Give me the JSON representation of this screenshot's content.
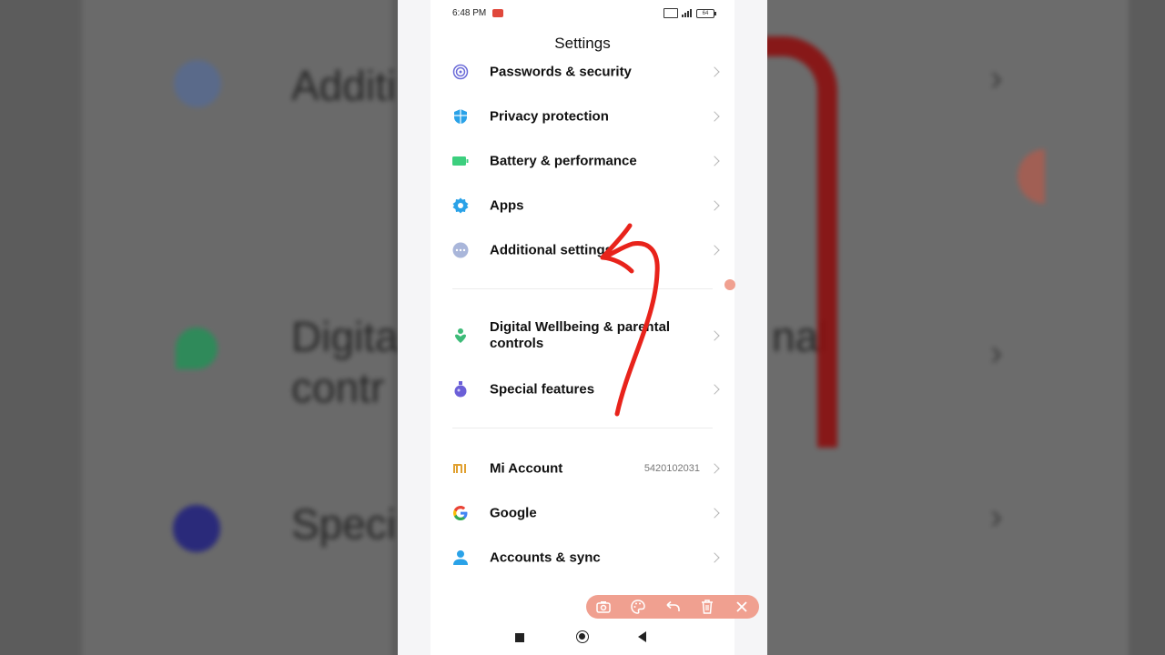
{
  "background": {
    "texts": [
      "Additi",
      "Digita",
      "contr",
      "nal",
      "Speci"
    ]
  },
  "status_bar": {
    "time": "6:48 PM",
    "battery": "64"
  },
  "header": {
    "title": "Settings"
  },
  "settings_items": [
    {
      "label": "Passwords & security",
      "icon": "fingerprint-icon"
    },
    {
      "label": "Privacy protection",
      "icon": "shield-icon"
    },
    {
      "label": "Battery & performance",
      "icon": "battery-icon"
    },
    {
      "label": "Apps",
      "icon": "gear-icon"
    },
    {
      "label": "Additional settings",
      "icon": "more-dots-icon"
    },
    {
      "label": "Digital Wellbeing & parental controls",
      "icon": "heart-person-icon"
    },
    {
      "label": "Special features",
      "icon": "potion-icon"
    },
    {
      "label": "Mi Account",
      "icon": "mi-logo-icon",
      "value": "5420102031"
    },
    {
      "label": "Google",
      "icon": "google-g-icon"
    },
    {
      "label": "Accounts & sync",
      "icon": "person-icon"
    }
  ],
  "annotation_toolbar": {
    "buttons": [
      "camera-icon",
      "palette-icon",
      "undo-icon",
      "trash-icon",
      "close-icon"
    ]
  },
  "colors": {
    "annotation_red": "#e8231b",
    "toolbar_bg": "#f0a090",
    "accent_blue": "#2aa2e8",
    "battery_green": "#3ccf7e",
    "wellbeing_green": "#3dbb78",
    "special_purple": "#6b5fd8",
    "mi_orange": "#e0a030"
  }
}
